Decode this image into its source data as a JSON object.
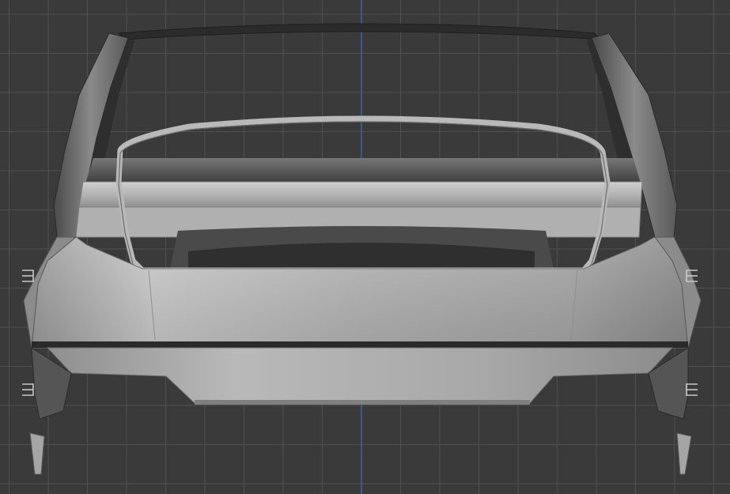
{
  "viewport": {
    "kind": "3d-viewport",
    "background_color": "#3a3a3a",
    "grid_minor_color": "#474747",
    "grid_major_color": "#505050",
    "axis_line_color": "#3e5fa8",
    "axis_shown": "vertical-blue",
    "grid": true
  },
  "model": {
    "subject": "car-body-rear-shell",
    "view": "rear-orthographic",
    "base_color": "#a9a9a9",
    "highlight_color": "#cfcfcf",
    "shadow_color": "#6e6e6e",
    "dark_color": "#2a2a2a"
  }
}
